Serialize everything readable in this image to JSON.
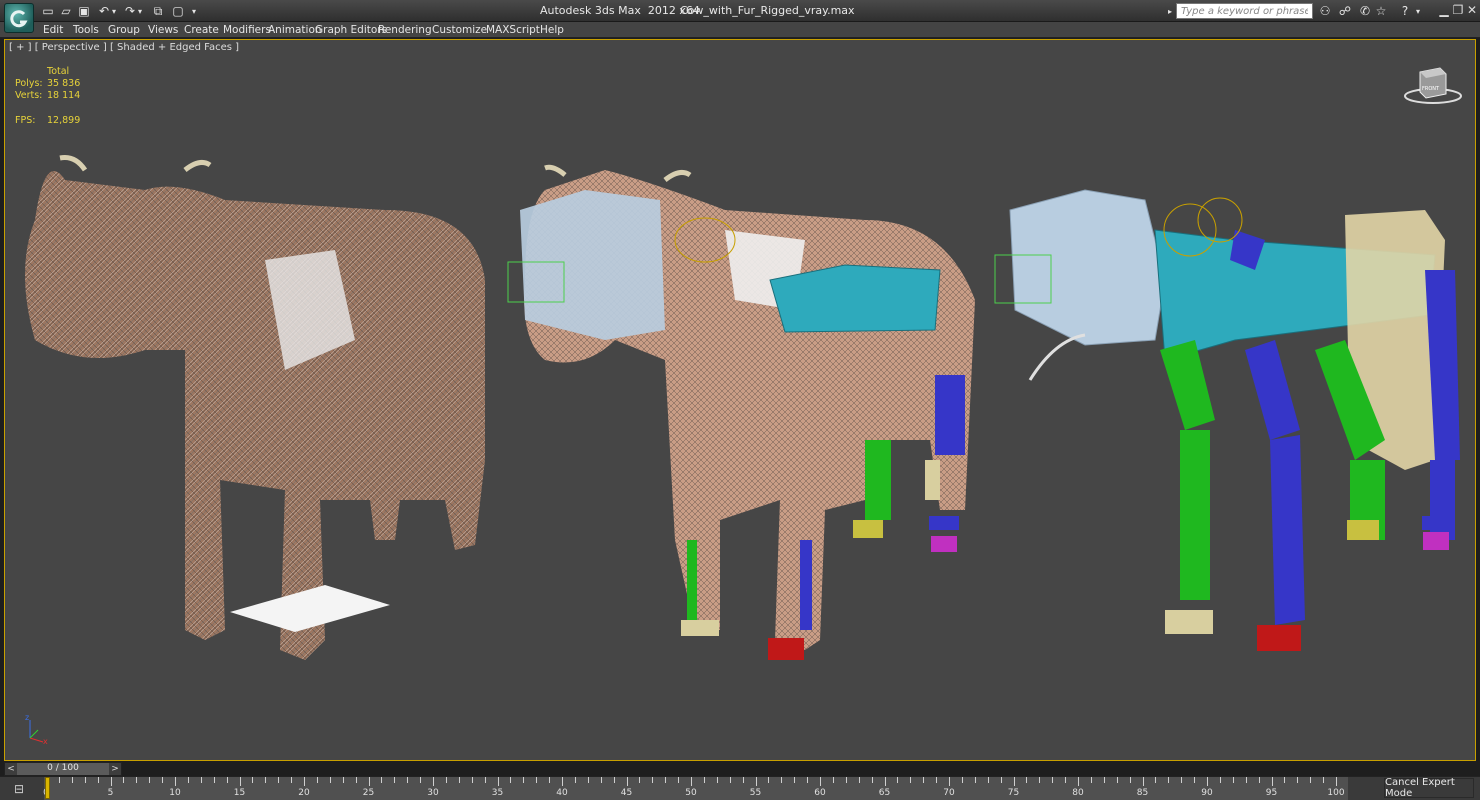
{
  "titlebar": {
    "app_name": "Autodesk 3ds Max  2012 x64",
    "file_name": "Cow_with_Fur_Rigged_vray.max",
    "search_placeholder": "Type a keyword or phrase",
    "help_icon": "?"
  },
  "menu": [
    {
      "label": "Edit"
    },
    {
      "label": "Tools"
    },
    {
      "label": "Group"
    },
    {
      "label": "Views"
    },
    {
      "label": "Create"
    },
    {
      "label": "Modifiers"
    },
    {
      "label": "Animation"
    },
    {
      "label": "Graph Editors"
    },
    {
      "label": "Rendering"
    },
    {
      "label": "Customize"
    },
    {
      "label": "MAXScript"
    },
    {
      "label": "Help"
    }
  ],
  "viewport": {
    "label": "[ + ] [ Perspective ] [ Shaded + Edged Faces ]",
    "stats": {
      "header": "Total",
      "polys_label": "Polys:",
      "polys_value": "35 836",
      "verts_label": "Verts:",
      "verts_value": "18 114",
      "fps_label": "FPS:",
      "fps_value": "12,899"
    },
    "viewcube_label": "FRONT"
  },
  "time_slider": {
    "text": "0 / 100",
    "prev": "<",
    "next": ">"
  },
  "track": {
    "labels": [
      "0",
      "5",
      "10",
      "15",
      "20",
      "25",
      "30",
      "35",
      "40",
      "45",
      "50",
      "55",
      "60",
      "65",
      "70",
      "75",
      "80",
      "85",
      "90",
      "95",
      "100"
    ]
  },
  "status": {
    "cancel_expert": "Cancel Expert Mode"
  },
  "colors": {
    "viewport_bg": "#464646",
    "active_border": "#c8a000",
    "stats_text": "#e6d23a",
    "bone_cyan": "#2eaabc",
    "bone_green": "#1fb81f",
    "bone_blue": "#3636c8",
    "bone_pale": "#a8c4dc"
  }
}
